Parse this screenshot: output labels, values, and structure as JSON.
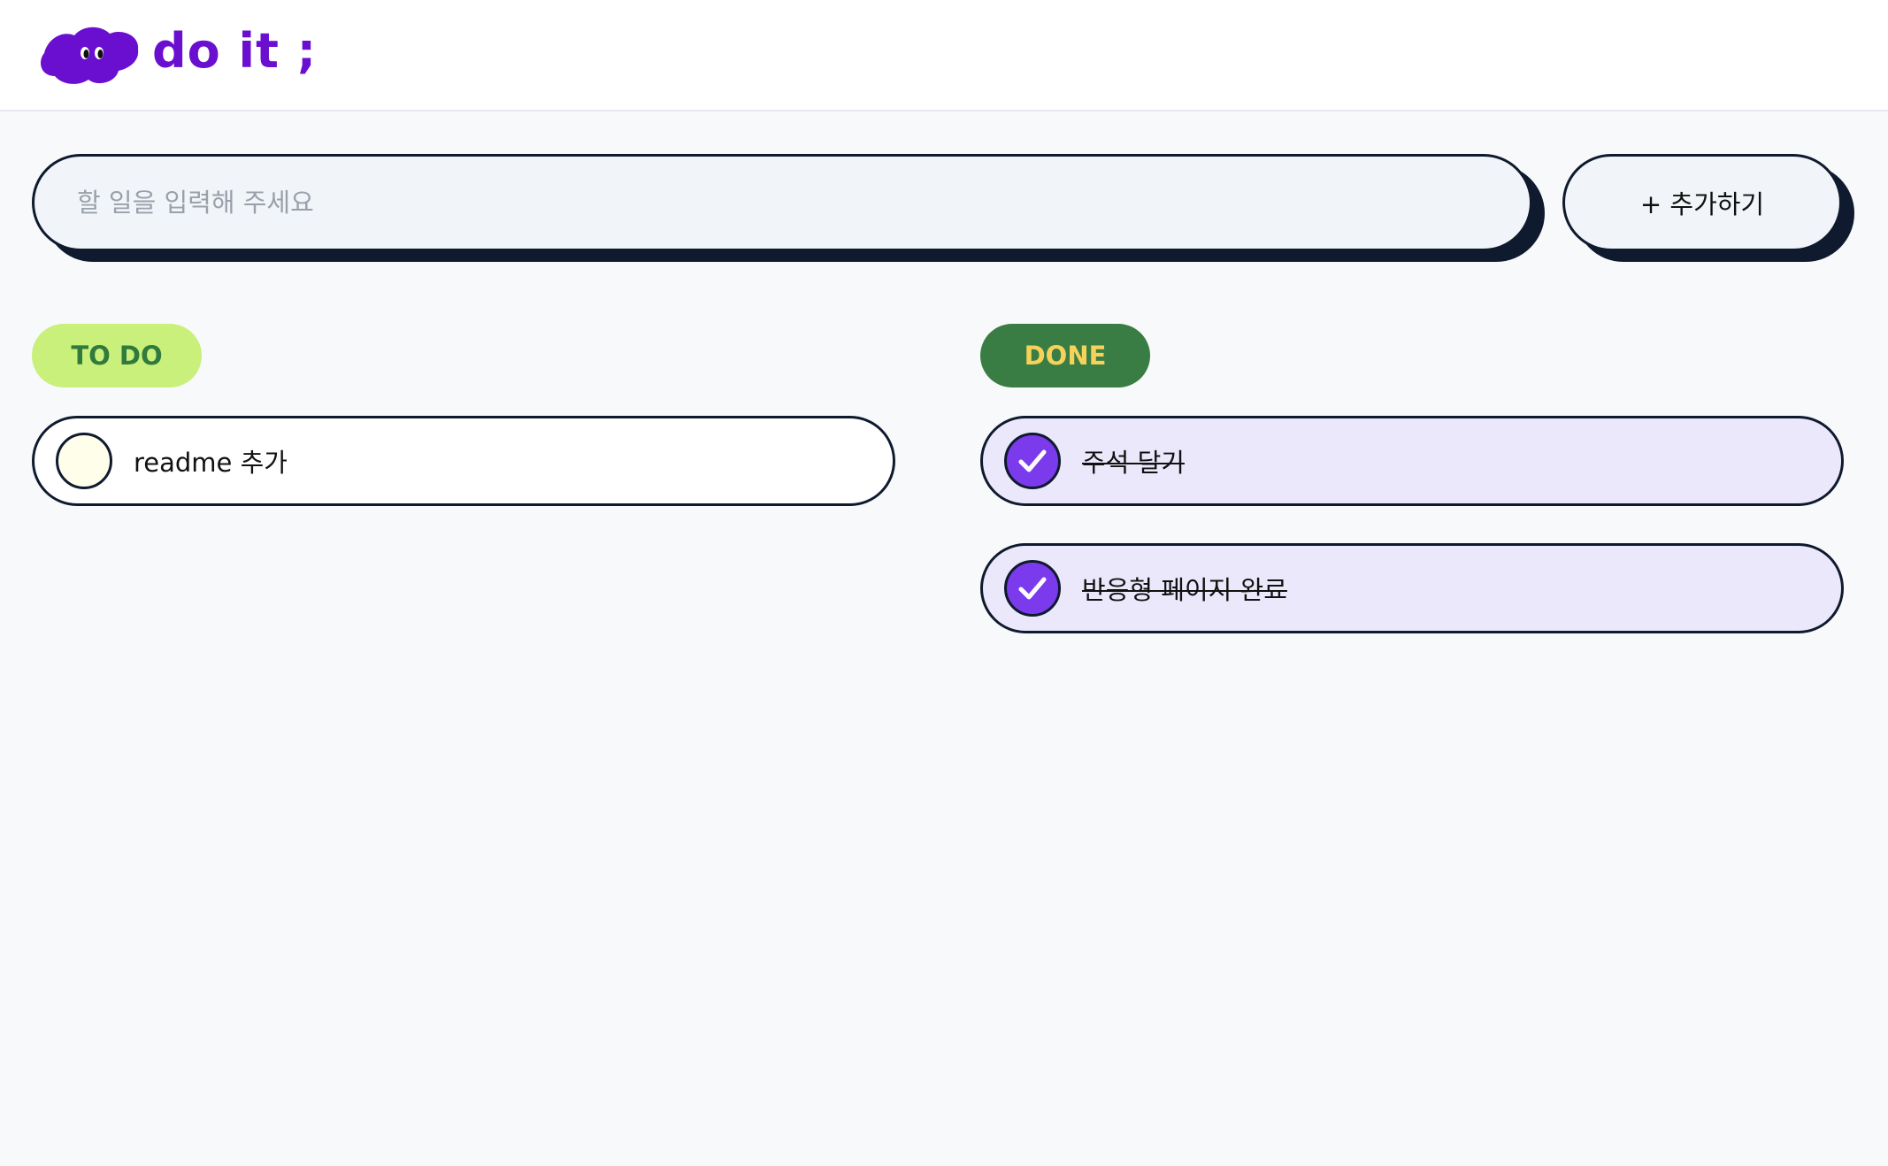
{
  "header": {
    "logo_text": "do it ;",
    "logo_color": "#6a0fd0"
  },
  "input": {
    "placeholder": "할 일을 입력해 주세요",
    "value": ""
  },
  "add_button": {
    "label": "+ 추가하기"
  },
  "todo": {
    "title": "TO DO",
    "badge_bg": "#c8f07a",
    "badge_fg": "#2f7a3c",
    "items": [
      {
        "text": "readme 추가",
        "checked": false
      }
    ]
  },
  "done": {
    "title": "DONE",
    "badge_bg": "#3a7d44",
    "badge_fg": "#f6d25a",
    "items": [
      {
        "text": "주석 달기",
        "checked": true
      },
      {
        "text": "반응형 페이지 완료",
        "checked": true
      }
    ]
  },
  "colors": {
    "accent": "#7c3aed",
    "border": "#0f1a2e",
    "done_item_bg": "#ece8fb"
  },
  "icons": {
    "logo": "cloud-with-eyes-icon",
    "check": "checkmark-icon"
  }
}
